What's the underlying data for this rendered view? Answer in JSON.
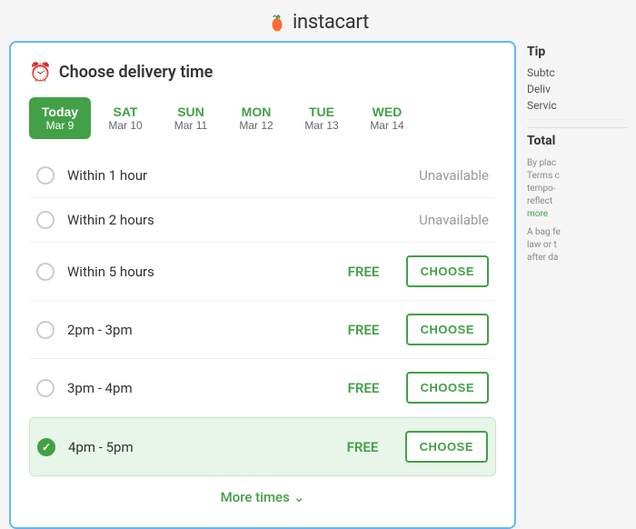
{
  "header": {
    "logo_text": "instacart"
  },
  "card": {
    "title": "Choose delivery time",
    "days": [
      {
        "id": "today",
        "name": "Today",
        "date": "Mar 9",
        "active": true
      },
      {
        "id": "sat",
        "name": "SAT",
        "date": "Mar 10",
        "active": false
      },
      {
        "id": "sun",
        "name": "SUN",
        "date": "Mar 11",
        "active": false
      },
      {
        "id": "mon",
        "name": "MON",
        "date": "Mar 12",
        "active": false
      },
      {
        "id": "tue",
        "name": "TUE",
        "date": "Mar 13",
        "active": false
      },
      {
        "id": "wed",
        "name": "WED",
        "date": "Mar 14",
        "active": false
      }
    ],
    "slots": [
      {
        "id": "slot-1hr",
        "label": "Within 1 hour",
        "price": "Unavailable",
        "unavailable": true,
        "selected": false,
        "showBtn": false
      },
      {
        "id": "slot-2hr",
        "label": "Within 2 hours",
        "price": "Unavailable",
        "unavailable": true,
        "selected": false,
        "showBtn": false
      },
      {
        "id": "slot-5hr",
        "label": "Within 5 hours",
        "price": "FREE",
        "unavailable": false,
        "selected": false,
        "showBtn": true
      },
      {
        "id": "slot-2-3pm",
        "label": "2pm - 3pm",
        "price": "FREE",
        "unavailable": false,
        "selected": false,
        "showBtn": true
      },
      {
        "id": "slot-3-4pm",
        "label": "3pm - 4pm",
        "price": "FREE",
        "unavailable": false,
        "selected": false,
        "showBtn": true
      },
      {
        "id": "slot-4-5pm",
        "label": "4pm - 5pm",
        "price": "FREE",
        "unavailable": false,
        "selected": true,
        "showBtn": true
      }
    ],
    "more_times_label": "More times",
    "choose_label": "CHOOSE"
  },
  "sidebar": {
    "tip_label": "Tip",
    "rows": [
      {
        "label": "Subtc"
      },
      {
        "label": "Deliv"
      },
      {
        "label": "Servic"
      }
    ],
    "total_label": "Total",
    "note1": "By plac\nTerms c\ntempo-\nreflect",
    "more_label": "more",
    "note2": "A bag fe\nlaw or t\nafter da"
  }
}
